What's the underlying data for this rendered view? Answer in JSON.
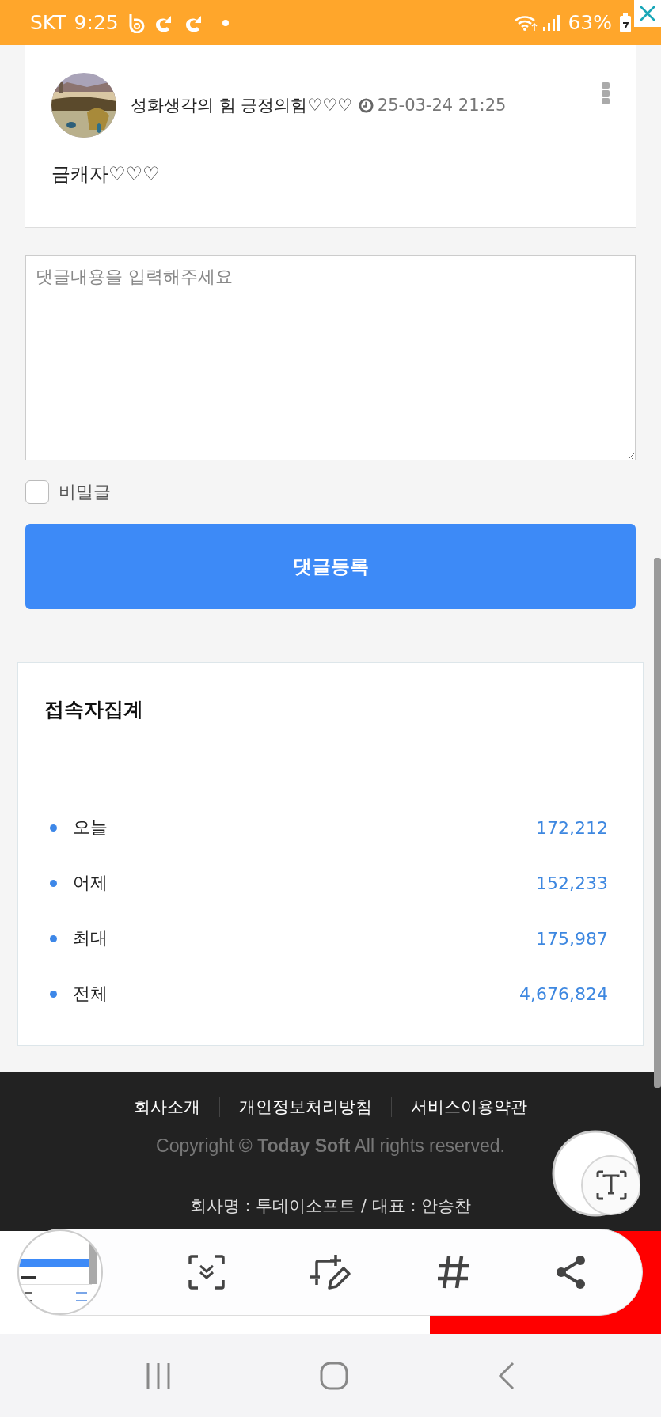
{
  "status_bar": {
    "carrier": "SKT",
    "time": "9:25",
    "battery": "63%"
  },
  "comment": {
    "author": "성화생각의 힘 긍정의힘♡♡♡",
    "date": "25-03-24 21:25",
    "body": "금캐자♡♡♡"
  },
  "comment_form": {
    "placeholder": "댓글내용을 입력해주세요",
    "secret": {
      "label": "비밀글",
      "checked": false
    },
    "submit": "댓글등록"
  },
  "visitor_stats": {
    "title": "접속자집계",
    "rows": [
      {
        "label": "오늘",
        "value": "172,212"
      },
      {
        "label": "어제",
        "value": "152,233"
      },
      {
        "label": "최대",
        "value": "175,987"
      },
      {
        "label": "전체",
        "value": "4,676,824"
      }
    ]
  },
  "footer": {
    "links": [
      "회사소개",
      "개인정보처리방침",
      "서비스이용약관"
    ],
    "copyright": "Copyright © **Today Soft** All rights reserved.",
    "company": "회사명 : 투데이소프트 / 대표 : 안승찬"
  }
}
